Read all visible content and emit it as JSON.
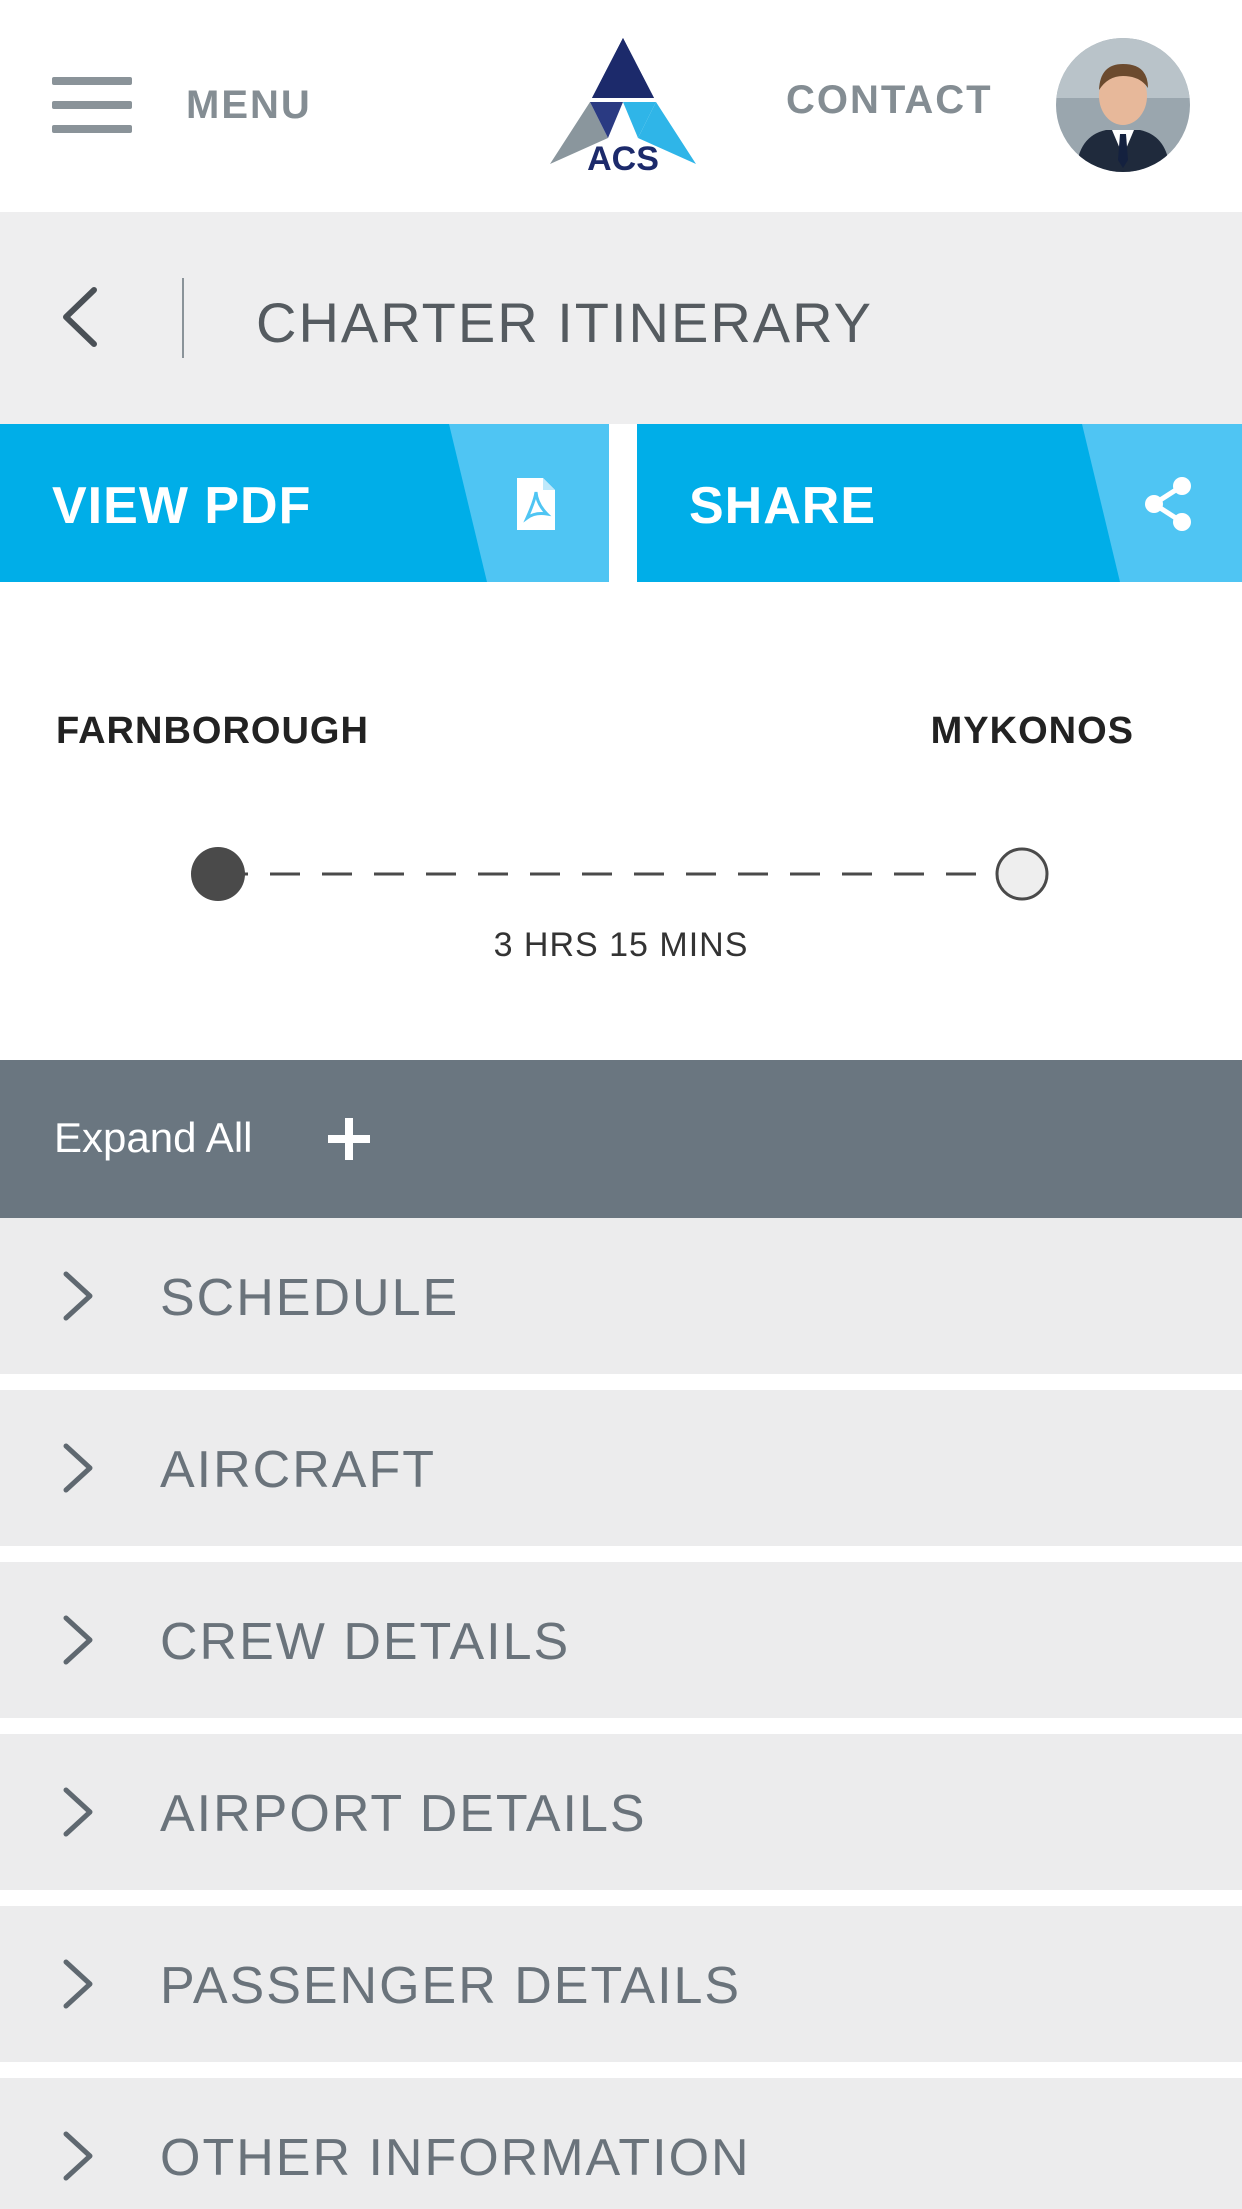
{
  "header": {
    "menu_label": "MENU",
    "logo_text": "ACS",
    "contact_label": "CONTACT",
    "colors": {
      "logo_dark": "#1c2a6b",
      "logo_light": "#2fb5e8",
      "logo_grey": "#8a969d"
    }
  },
  "titlebar": {
    "title": "CHARTER ITINERARY"
  },
  "actions": {
    "view_pdf_label": "VIEW PDF",
    "share_label": "SHARE",
    "pdf_icon": "pdf-file-icon",
    "share_icon": "share-icon",
    "colors": {
      "primary": "#00aee8",
      "accent": "#4fc5f3"
    }
  },
  "route": {
    "origin": "FARNBOROUGH",
    "destination": "MYKONOS",
    "duration": "3 HRS 15 MINS"
  },
  "expand_all": {
    "label": "Expand All"
  },
  "sections": [
    {
      "label": "SCHEDULE"
    },
    {
      "label": "AIRCRAFT"
    },
    {
      "label": "CREW DETAILS"
    },
    {
      "label": "AIRPORT DETAILS"
    },
    {
      "label": "PASSENGER DETAILS"
    },
    {
      "label": "OTHER INFORMATION"
    }
  ]
}
